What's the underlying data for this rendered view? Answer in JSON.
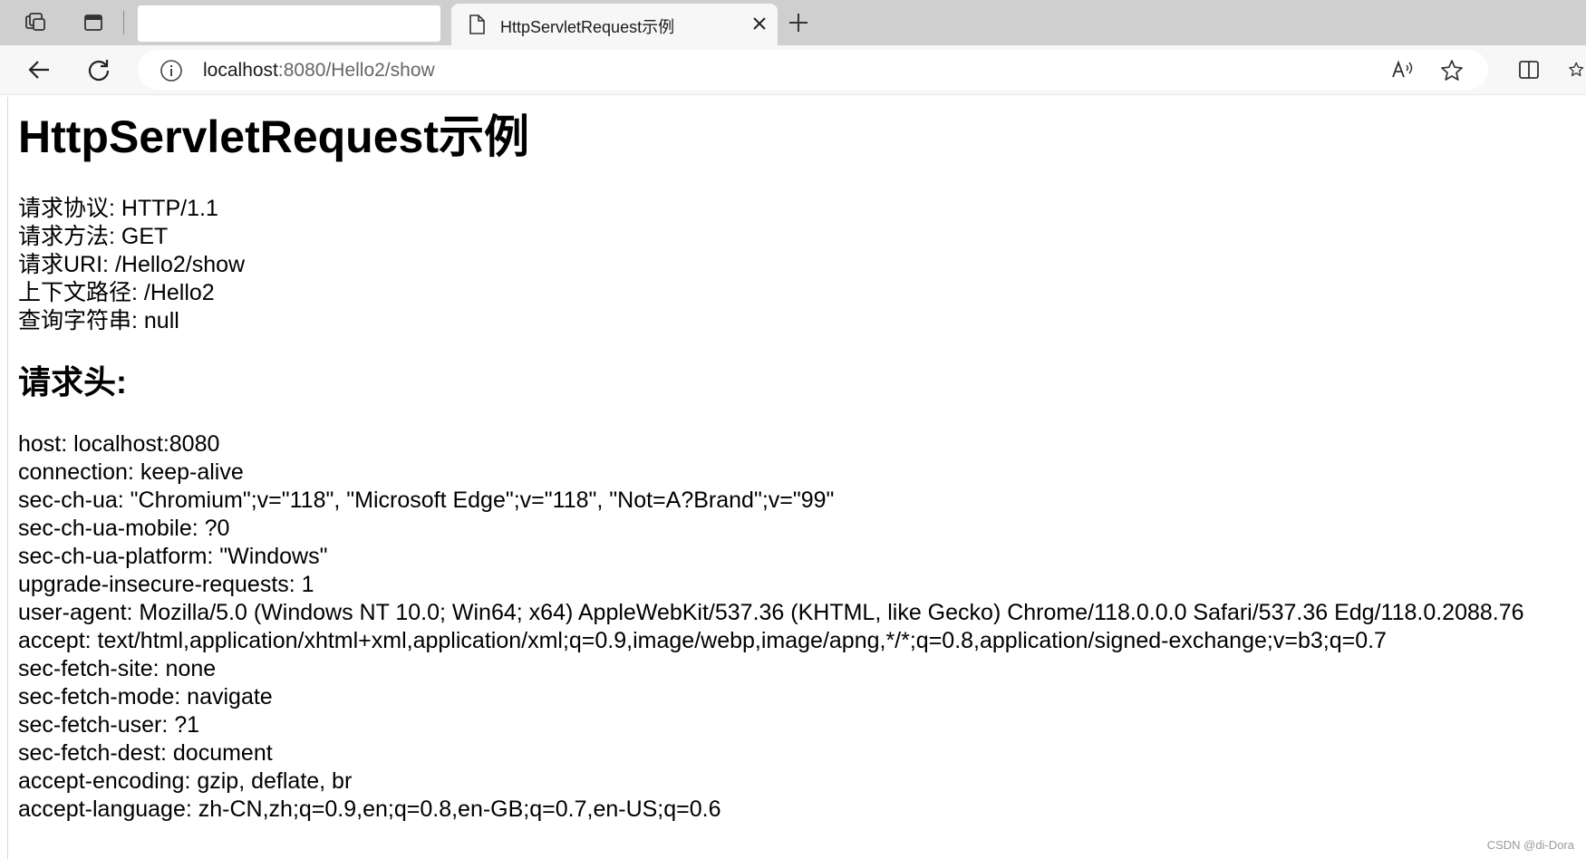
{
  "browser": {
    "tab": {
      "title": "HttpServletRequest示例"
    },
    "address": {
      "host": "localhost",
      "rest": ":8080/Hello2/show"
    }
  },
  "page": {
    "title": "HttpServletRequest示例",
    "info_lines": [
      "请求协议: HTTP/1.1",
      "请求方法: GET",
      "请求URI: /Hello2/show",
      "上下文路径: /Hello2",
      "查询字符串: null"
    ],
    "headers_title": "请求头:",
    "header_lines": [
      "host: localhost:8080",
      "connection: keep-alive",
      "sec-ch-ua: \"Chromium\";v=\"118\", \"Microsoft Edge\";v=\"118\", \"Not=A?Brand\";v=\"99\"",
      "sec-ch-ua-mobile: ?0",
      "sec-ch-ua-platform: \"Windows\"",
      "upgrade-insecure-requests: 1",
      "user-agent: Mozilla/5.0 (Windows NT 10.0; Win64; x64) AppleWebKit/537.36 (KHTML, like Gecko) Chrome/118.0.0.0 Safari/537.36 Edg/118.0.2088.76",
      "accept: text/html,application/xhtml+xml,application/xml;q=0.9,image/webp,image/apng,*/*;q=0.8,application/signed-exchange;v=b3;q=0.7",
      "sec-fetch-site: none",
      "sec-fetch-mode: navigate",
      "sec-fetch-user: ?1",
      "sec-fetch-dest: document",
      "accept-encoding: gzip, deflate, br",
      "accept-language: zh-CN,zh;q=0.9,en;q=0.8,en-GB;q=0.7,en-US;q=0.6"
    ]
  },
  "watermark": "CSDN @di-Dora"
}
